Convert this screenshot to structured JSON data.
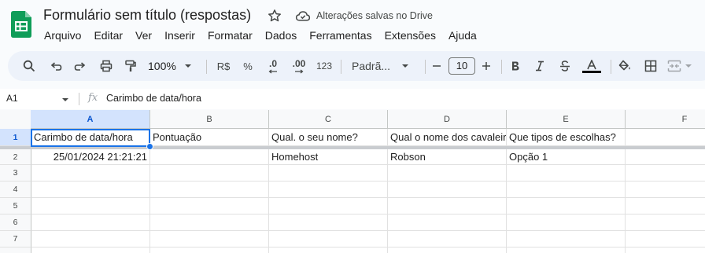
{
  "document": {
    "title": "Formulário sem título (respostas)",
    "save_status": "Alterações salvas no Drive"
  },
  "menu": [
    "Arquivo",
    "Editar",
    "Ver",
    "Inserir",
    "Formatar",
    "Dados",
    "Ferramentas",
    "Extensões",
    "Ajuda"
  ],
  "toolbar": {
    "zoom": "100%",
    "currency": "R$",
    "percent": "%",
    "decrease_decimals": ".0",
    "increase_decimals": ".00",
    "number_format": "123",
    "font": "Padrã...",
    "font_size": "10",
    "icons": [
      "search-icon",
      "undo-icon",
      "redo-icon",
      "print-icon",
      "paint-format-icon",
      "bold-icon",
      "italic-icon",
      "strikethrough-icon",
      "text-color-icon",
      "fill-color-icon",
      "borders-icon",
      "merge-cells-icon"
    ]
  },
  "formula_bar": {
    "name_box": "A1",
    "fx": "fx",
    "content": "Carimbo de data/hora"
  },
  "sheet": {
    "columns": [
      "A",
      "B",
      "C",
      "D",
      "E",
      "F"
    ],
    "rows": [
      "1",
      "2",
      "3",
      "4",
      "5",
      "6",
      "7"
    ],
    "header_row": [
      "Carimbo de data/hora",
      "Pontuação",
      "Qual. o seu nome?",
      "Qual o nome dos cavaleiros",
      "Que tipos de escolhas?",
      ""
    ],
    "data_row": [
      "25/01/2024 21:21:21",
      "",
      "Homehost",
      "Robson",
      "Opção 1",
      ""
    ],
    "selected_cell": "A1"
  },
  "colors": {
    "accent": "#1a73e8",
    "sheets_green": "#0f9d58"
  }
}
